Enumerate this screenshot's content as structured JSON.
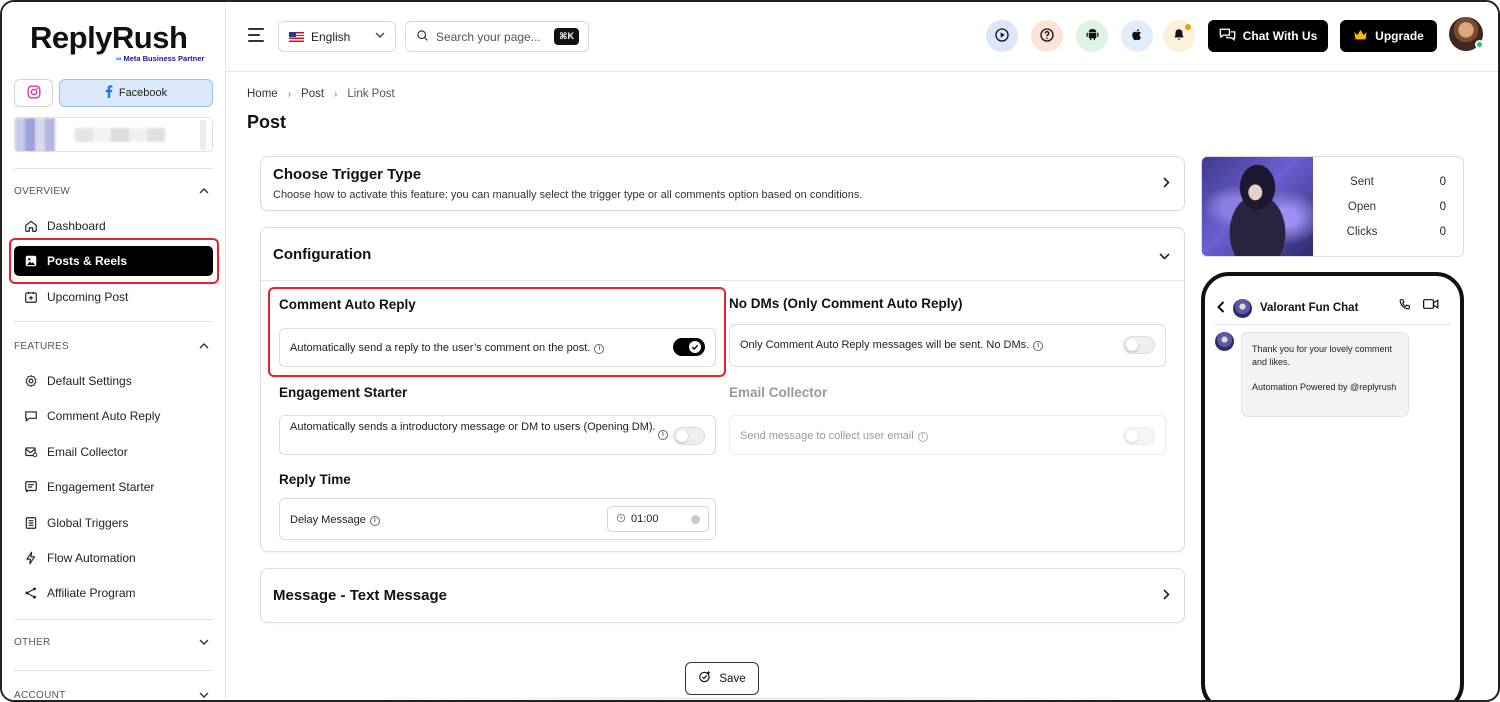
{
  "brand": {
    "name": "ReplyRush",
    "partner_prefix": "∞",
    "partner": "Meta Business Partner"
  },
  "platforms": {
    "instagram_icon": "instagram-icon",
    "facebook_label": "Facebook"
  },
  "sidebar": {
    "sections": [
      {
        "label": "OVERVIEW",
        "items": [
          {
            "label": "Dashboard",
            "icon": "home-icon"
          },
          {
            "label": "Posts & Reels",
            "icon": "image-icon",
            "active": true
          },
          {
            "label": "Upcoming Post",
            "icon": "calendar-plus-icon"
          }
        ]
      },
      {
        "label": "FEATURES",
        "items": [
          {
            "label": "Default Settings",
            "icon": "gear-icon"
          },
          {
            "label": "Comment Auto Reply",
            "icon": "comment-icon"
          },
          {
            "label": "Email Collector",
            "icon": "mail-icon"
          },
          {
            "label": "Engagement Starter",
            "icon": "message-lines-icon"
          },
          {
            "label": "Global Triggers",
            "icon": "list-icon"
          },
          {
            "label": "Flow Automation",
            "icon": "lightning-icon"
          },
          {
            "label": "Affiliate Program",
            "icon": "share-nodes-icon"
          }
        ]
      },
      {
        "label": "OTHER"
      },
      {
        "label": "ACCOUNT"
      }
    ]
  },
  "topbar": {
    "language": "English",
    "search_placeholder": "Search your page...",
    "search_shortcut": "⌘K",
    "chat_button": "Chat With Us",
    "upgrade_button": "Upgrade",
    "accent_colors": {
      "play": "#dbe6fb",
      "help": "#fbe5d6",
      "android": "#dff3e4",
      "apple": "#e3ecfb",
      "bell": "#fdf1dc"
    }
  },
  "breadcrumb": [
    "Home",
    "Post",
    "Link Post"
  ],
  "page_title": "Post",
  "trigger_card": {
    "title": "Choose Trigger Type",
    "subtitle": "Choose how to activate this feature: you can manually select the trigger type or all comments option based on conditions."
  },
  "config_card": {
    "title": "Configuration",
    "comment_auto_reply": {
      "label": "Comment Auto Reply",
      "description": "Automatically send a reply to the user’s comment on the post.",
      "enabled": true
    },
    "no_dms": {
      "label": "No DMs (Only Comment Auto Reply)",
      "description": "Only Comment Auto Reply messages will be sent. No DMs.",
      "enabled": false
    },
    "engagement_starter": {
      "label": "Engagement Starter",
      "description": "Automatically sends a introductory message or DM to users (Opening DM).",
      "enabled": false
    },
    "email_collector": {
      "label": "Email Collector",
      "description": "Send message to collect user email",
      "enabled": false,
      "disabled": true
    },
    "reply_time": {
      "label": "Reply Time",
      "field_label": "Delay Message",
      "value": "01:00"
    }
  },
  "message_card": {
    "title": "Message - Text Message"
  },
  "save_label": "Save",
  "stats": {
    "rows": [
      {
        "label": "Sent",
        "value": "0"
      },
      {
        "label": "Open",
        "value": "0"
      },
      {
        "label": "Clicks",
        "value": "0"
      }
    ]
  },
  "preview": {
    "chat_name": "Valorant Fun Chat",
    "message_line1": "Thank you for your lovely comment and likes.",
    "message_line2": "Automation Powered by @replyrush"
  }
}
